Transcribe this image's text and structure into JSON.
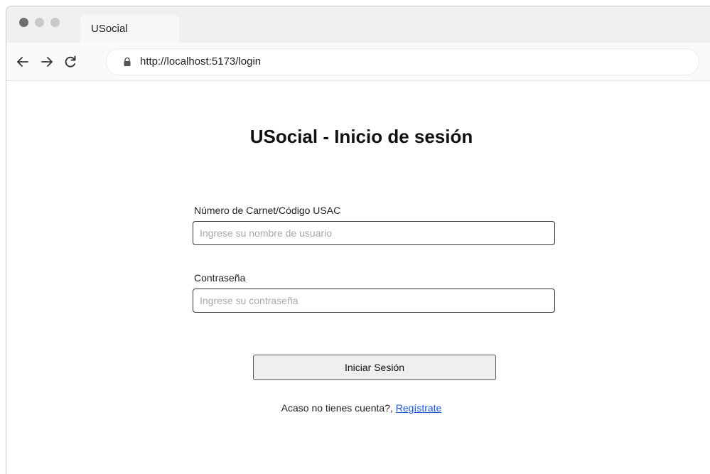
{
  "browser": {
    "tab_title": "USocial",
    "url": "http://localhost:5173/login",
    "icons": {
      "back": "arrow-left-icon",
      "forward": "arrow-right-icon",
      "reload": "reload-icon",
      "secure": "lock-icon"
    }
  },
  "login": {
    "title": "USocial - Inicio de sesión",
    "username_label": "Número de Carnet/Código USAC",
    "username_placeholder": "Ingrese su nombre de usuario",
    "username_value": "",
    "password_label": "Contraseña",
    "password_placeholder": "Ingrese su contraseña",
    "password_value": "",
    "submit_label": "Iniciar Sesión",
    "register_prompt": "Acaso no tienes cuenta?, ",
    "register_link": "Regístrate"
  },
  "colors": {
    "link": "#1a56d6",
    "button_bg": "#efefef",
    "chrome_bg": "#f0f0f0"
  }
}
